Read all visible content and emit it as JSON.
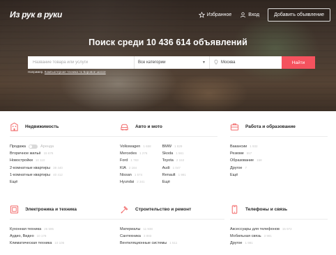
{
  "header": {
    "logo": "Из рук в руки",
    "favorites": "Избранное",
    "login": "Вход",
    "add_button": "Добавить объявление"
  },
  "hero": {
    "title": "Поиск среди 10 436 614 объявлений",
    "search_placeholder": "Название товара или услуги",
    "category_value": "Все категории",
    "city_value": "Москва",
    "find_button": "Найти",
    "example_label": "Например,",
    "example_link": "Компьютерная техника по Боровое шоссе"
  },
  "colors": {
    "accent": "#f5525e",
    "icon": "#f26b6b"
  },
  "categories": [
    {
      "title": "Недвижимость",
      "icon": "building-icon",
      "toggle_left": "Продажа",
      "toggle_right": "Аренда",
      "items": [
        {
          "label": "Вторичное жильё",
          "count": "15 676"
        },
        {
          "label": "Новостройки",
          "count": "10 110"
        },
        {
          "label": "2-комнатные квартиры",
          "count": "38 440"
        },
        {
          "label": "1-комнатные квартиры",
          "count": "40 412"
        }
      ],
      "more": "Ещё"
    },
    {
      "title": "Авто и мото",
      "icon": "car-icon",
      "col1": [
        {
          "label": "Volkswagen",
          "count": "1 658"
        },
        {
          "label": "Mercedes",
          "count": "1 276"
        },
        {
          "label": "Ford",
          "count": "1 783"
        },
        {
          "label": "KIA",
          "count": "2 184"
        },
        {
          "label": "Nissan",
          "count": "1 574"
        },
        {
          "label": "Hyundai",
          "count": "2 341"
        }
      ],
      "col2": [
        {
          "label": "BMW",
          "count": "1 829"
        },
        {
          "label": "Skoda",
          "count": "1 561"
        },
        {
          "label": "Toyota",
          "count": "2 153"
        },
        {
          "label": "Audi",
          "count": "1 047"
        },
        {
          "label": "Renault",
          "count": "1 981"
        }
      ],
      "more": "Ещё"
    },
    {
      "title": "Работа и образование",
      "icon": "briefcase-icon",
      "items": [
        {
          "label": "Вакансии",
          "count": "1 932"
        },
        {
          "label": "Резюме",
          "count": "557"
        },
        {
          "label": "Образование",
          "count": "158"
        },
        {
          "label": "Другое",
          "count": "7"
        }
      ],
      "more": "Ещё"
    },
    {
      "title": "Электроника и техника",
      "icon": "monitor-icon",
      "items": [
        {
          "label": "Кухонная техника",
          "count": "26 595"
        },
        {
          "label": "Аудио, Видео",
          "count": "10 178"
        },
        {
          "label": "Климатическая техника",
          "count": "10 105"
        }
      ]
    },
    {
      "title": "Строительство и ремонт",
      "icon": "hammer-icon",
      "items": [
        {
          "label": "Материалы",
          "count": "11 938"
        },
        {
          "label": "Сантехника",
          "count": "3 893"
        },
        {
          "label": "Вентиляционные системы",
          "count": "1 511"
        }
      ]
    },
    {
      "title": "Телефоны и связь",
      "icon": "phone-icon",
      "items": [
        {
          "label": "Аксессуары для телефонов",
          "count": "15 972"
        },
        {
          "label": "Мобильная связь",
          "count": "3 981"
        },
        {
          "label": "Другое",
          "count": "1 981"
        }
      ]
    }
  ]
}
